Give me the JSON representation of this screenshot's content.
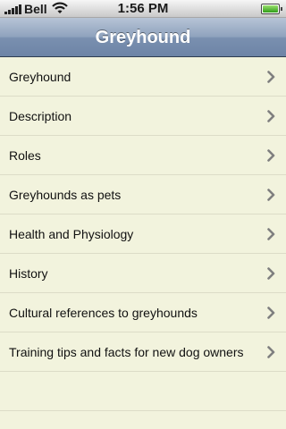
{
  "status_bar": {
    "carrier": "Bell",
    "time": "1:56 PM",
    "icons": [
      "signal-icon",
      "wifi-icon",
      "battery-icon"
    ]
  },
  "nav_bar": {
    "title": "Greyhound"
  },
  "list": {
    "items": [
      {
        "label": "Greyhound"
      },
      {
        "label": "Description"
      },
      {
        "label": "Roles"
      },
      {
        "label": "Greyhounds as pets"
      },
      {
        "label": "Health and Physiology"
      },
      {
        "label": "History"
      },
      {
        "label": "Cultural references to greyhounds"
      },
      {
        "label": "Training tips and facts for new dog owners"
      }
    ],
    "accessory_icon": "chevron-right-icon"
  },
  "colors": {
    "background": "#f2f3dd",
    "nav_bar": "#7a90b0",
    "separator": "#dcdcc7",
    "chevron": "#7f7f7f"
  }
}
